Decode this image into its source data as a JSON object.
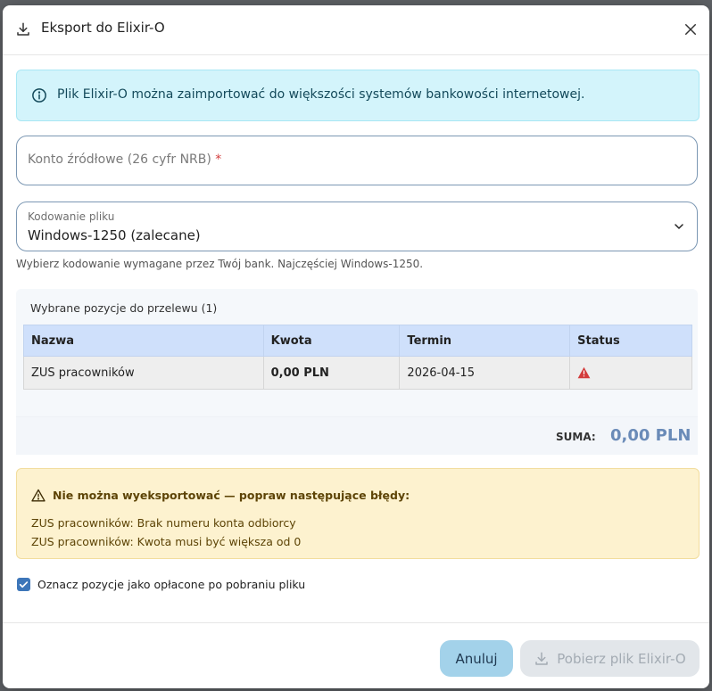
{
  "dialog": {
    "title": "Eksport do Elixir-O",
    "title_icon": "download-icon",
    "close_icon": "close-icon"
  },
  "info": {
    "icon": "info-icon",
    "text": "Plik Elixir-O można zaimportować do większości systemów bankowości internetowej."
  },
  "source_account": {
    "placeholder": "Konto źródłowe (26 cyfr NRB)",
    "required_mark": "*",
    "value": ""
  },
  "encoding": {
    "label": "Kodowanie pliku",
    "selected": "Windows-1250 (zalecane)",
    "hint": "Wybierz kodowanie wymagane przez Twój bank. Najczęściej Windows-1250."
  },
  "items": {
    "title": "Wybrane pozycje do przelewu (1)",
    "columns": [
      "Nazwa",
      "Kwota",
      "Termin",
      "Status"
    ],
    "rows": [
      {
        "name": "ZUS pracowników",
        "amount": "0,00 PLN",
        "due": "2026-04-15",
        "status_icon": "warning-icon"
      }
    ],
    "sum_label": "SUMA:",
    "sum_value": "0,00 PLN"
  },
  "errors": {
    "icon": "warning-icon",
    "title": "Nie można wyeksportować — popraw następujące błędy:",
    "lines": [
      "ZUS pracowników: Brak numeru konta odbiorcy",
      "ZUS pracowników: Kwota musi być większa od 0"
    ]
  },
  "mark_paid": {
    "checked": true,
    "label": "Oznacz pozycje jako opłacone po pobraniu pliku"
  },
  "footer": {
    "cancel_label": "Anuluj",
    "download_label": "Pobierz plik Elixir-O"
  },
  "colors": {
    "accent": "#3d76b9",
    "info_bg": "#d3f4fb",
    "warning_bg": "#fdf2cf",
    "status_error": "#d33c3c",
    "sum_value": "#6a8bb8"
  }
}
